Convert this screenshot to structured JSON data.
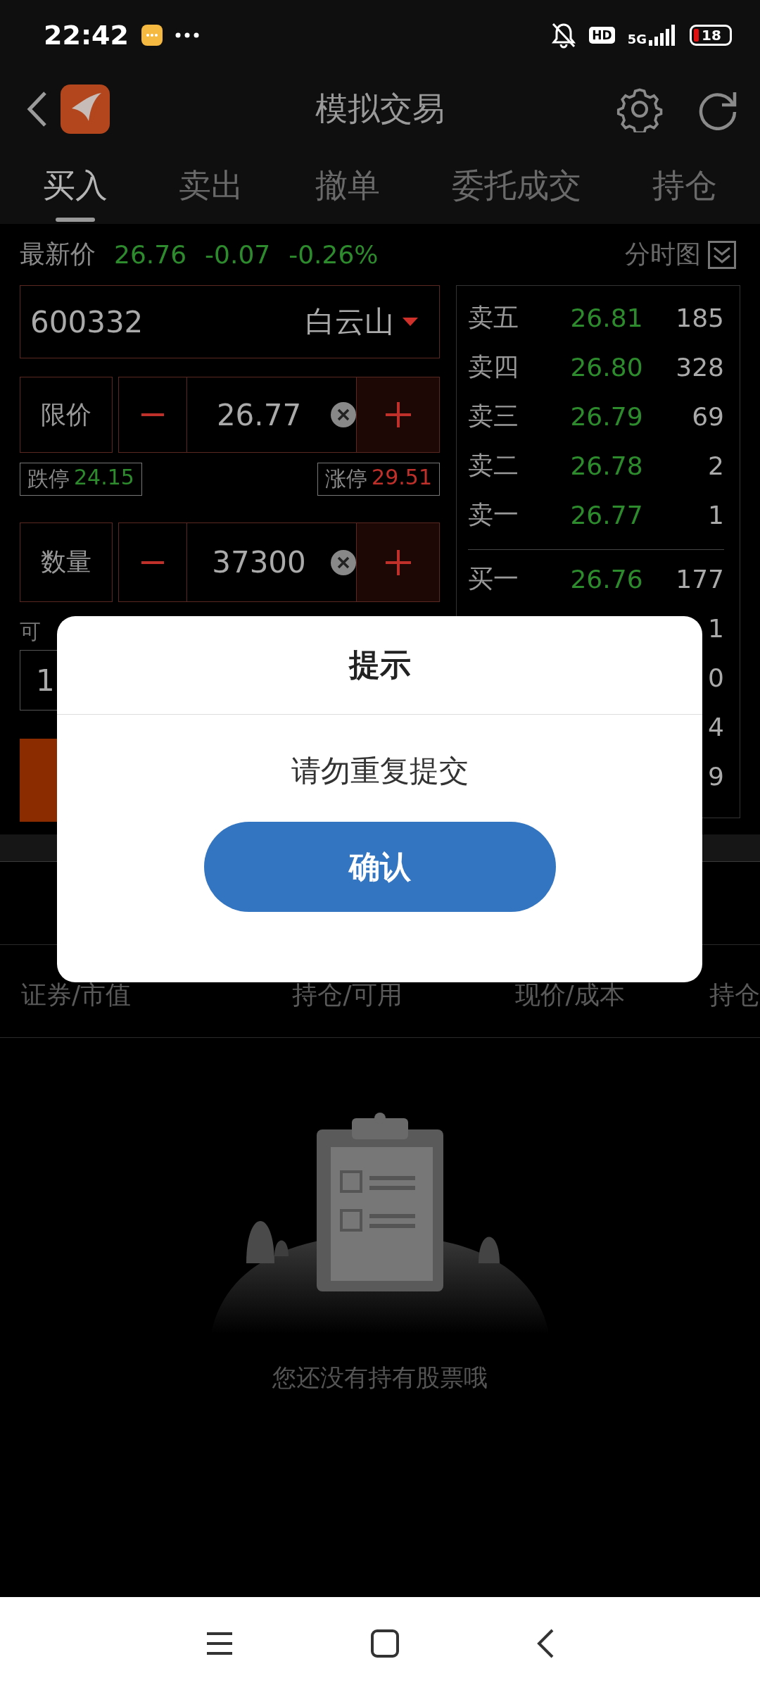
{
  "status_bar": {
    "time": "22:42",
    "network": "5G",
    "hd": "HD",
    "battery": "18"
  },
  "header": {
    "title": "模拟交易"
  },
  "tabs": [
    {
      "label": "买入",
      "selected": true
    },
    {
      "label": "卖出",
      "selected": false
    },
    {
      "label": "撤单",
      "selected": false
    },
    {
      "label": "委托成交",
      "selected": false
    },
    {
      "label": "持仓",
      "selected": false
    }
  ],
  "quote": {
    "label": "最新价",
    "price": "26.76",
    "change": "-0.07",
    "change_pct": "-0.26%",
    "chart_link": "分时图"
  },
  "order_form": {
    "stock_code": "600332",
    "stock_name": "白云山",
    "price_type": "限价",
    "price": "26.77",
    "limit_down": {
      "label": "跌停",
      "value": "24.15"
    },
    "limit_up": {
      "label": "涨停",
      "value": "29.51"
    },
    "quantity_label": "数量",
    "quantity": "37300",
    "available_label": "可",
    "available_value": "1"
  },
  "order_book": {
    "asks": [
      {
        "label": "卖五",
        "price": "26.81",
        "volume": "185"
      },
      {
        "label": "卖四",
        "price": "26.80",
        "volume": "328"
      },
      {
        "label": "卖三",
        "price": "26.79",
        "volume": "69"
      },
      {
        "label": "卖二",
        "price": "26.78",
        "volume": "2"
      },
      {
        "label": "卖一",
        "price": "26.77",
        "volume": "1"
      }
    ],
    "bids": [
      {
        "label": "买一",
        "price": "26.76",
        "volume": "177"
      },
      {
        "volume": "1"
      },
      {
        "volume": "0"
      },
      {
        "volume": "4"
      },
      {
        "volume": "9"
      }
    ]
  },
  "holdings": {
    "columns": [
      "证券/市值",
      "持仓/可用",
      "现价/成本",
      "持仓"
    ],
    "empty_text": "您还没有持有股票哦"
  },
  "dialog": {
    "title": "提示",
    "message": "请勿重复提交",
    "button": "确认"
  }
}
